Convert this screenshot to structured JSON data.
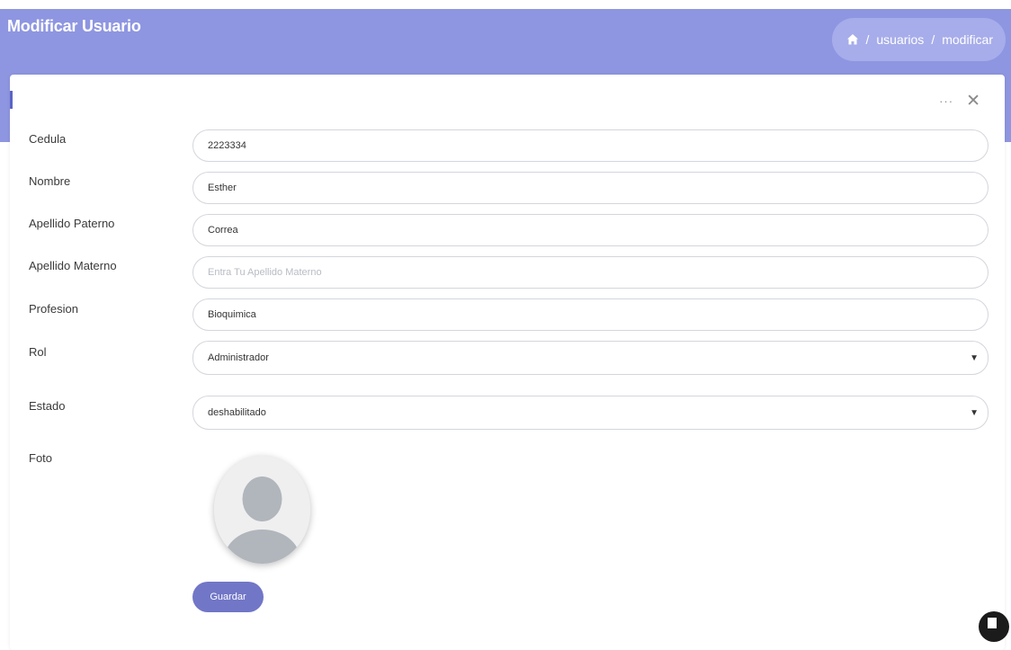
{
  "header": {
    "title": "Modificar Usuario",
    "breadcrumb": {
      "home_icon": "home-icon",
      "items": [
        "usuarios",
        "modificar"
      ],
      "separator": "/"
    }
  },
  "card": {
    "tools": {
      "more": "···",
      "close": "✕"
    }
  },
  "form": {
    "cedula": {
      "label": "Cedula",
      "value": "2223334"
    },
    "nombre": {
      "label": "Nombre",
      "value": "Esther"
    },
    "apellido_paterno": {
      "label": "Apellido Paterno",
      "value": "Correa"
    },
    "apellido_materno": {
      "label": "Apellido Materno",
      "value": "",
      "placeholder": "Entra Tu Apellido Materno"
    },
    "profesion": {
      "label": "Profesion",
      "value": "Bioquimica"
    },
    "rol": {
      "label": "Rol",
      "value": "Administrador"
    },
    "estado": {
      "label": "Estado",
      "value": "deshabilitado"
    },
    "foto": {
      "label": "Foto"
    },
    "save_label": "Guardar"
  },
  "colors": {
    "header_band": "#8e96e1",
    "breadcrumb_pill": "#a7adea",
    "button": "#7176c7"
  }
}
